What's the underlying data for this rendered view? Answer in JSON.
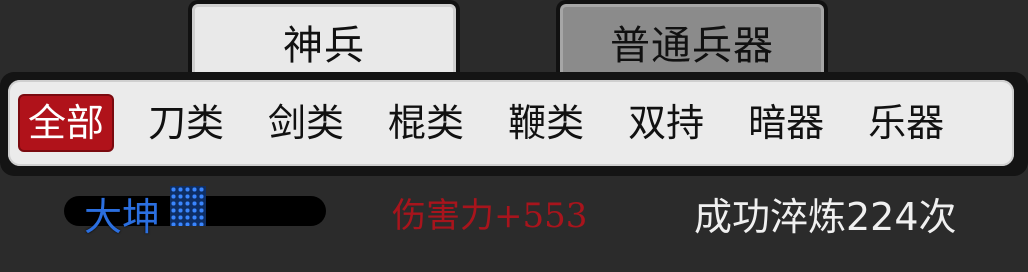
{
  "tabs": {
    "divine": "神兵",
    "normal": "普通兵器"
  },
  "categories": {
    "all": "全部",
    "blade": "刀类",
    "sword": "剑类",
    "staff": "棍类",
    "whip": "鞭类",
    "dual": "双持",
    "hidden": "暗器",
    "instrument": "乐器"
  },
  "item": {
    "name": "大坤",
    "damage": "伤害力+553",
    "refine": "成功淬炼224次"
  },
  "colors": {
    "selected_category": "#b0121a",
    "name": "#2b6fe0",
    "damage": "#a8141c"
  }
}
